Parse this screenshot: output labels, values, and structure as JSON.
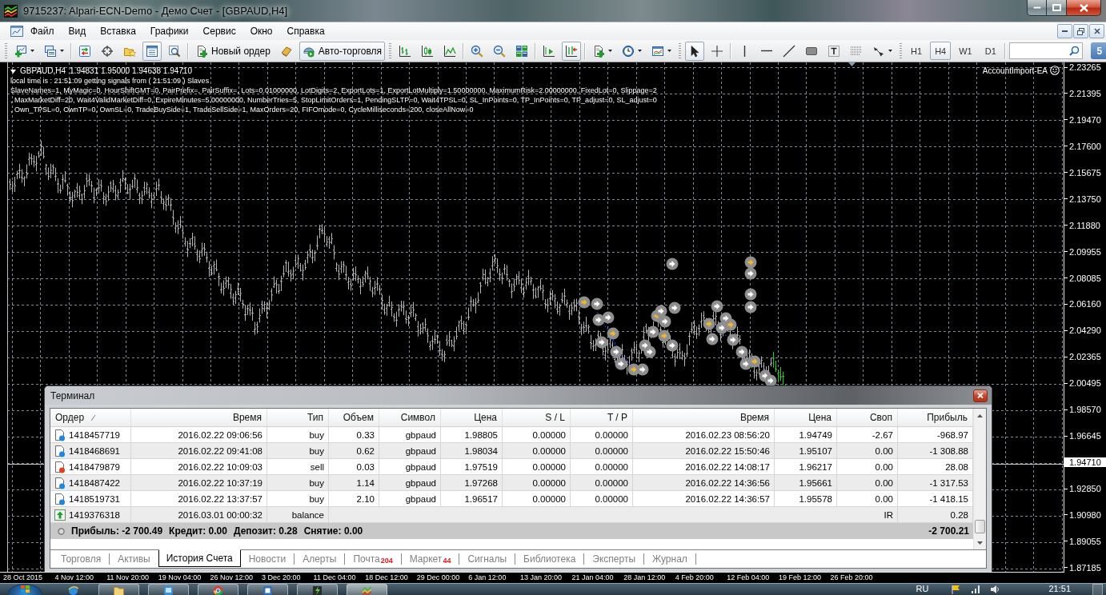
{
  "window": {
    "title": "9715237: Alpari-ECN-Demo - Демо Счет - [GBPAUD,H4]"
  },
  "menu": [
    "Файл",
    "Вид",
    "Вставка",
    "Графики",
    "Сервис",
    "Окно",
    "Справка"
  ],
  "toolbar": {
    "tools": [
      {
        "kind": "icon",
        "dropdown": true,
        "pressed": false
      },
      {
        "kind": "icon",
        "dropdown": true,
        "pressed": false
      },
      {
        "kind": "icon",
        "dropdown": false,
        "pressed": false
      },
      {
        "kind": "icon",
        "dropdown": false,
        "pressed": false
      },
      {
        "kind": "icon",
        "dropdown": false,
        "pressed": false
      },
      {
        "kind": "icon",
        "dropdown": false,
        "pressed": true
      },
      {
        "kind": "icon",
        "dropdown": false,
        "pressed": false
      },
      {
        "kind": "labeled",
        "label": "Новый ордер",
        "dropdown": false,
        "pressed": false
      },
      {
        "kind": "icon",
        "dropdown": false,
        "pressed": false
      },
      {
        "kind": "labeled",
        "label": "Авто-торговля",
        "dropdown": false,
        "pressed": true
      },
      {
        "kind": "icon",
        "dropdown": false,
        "pressed": false
      },
      {
        "kind": "icon",
        "dropdown": false,
        "pressed": false
      },
      {
        "kind": "icon",
        "dropdown": false,
        "pressed": false
      },
      {
        "kind": "icon",
        "dropdown": false,
        "pressed": false
      },
      {
        "kind": "icon",
        "dropdown": false,
        "pressed": false
      },
      {
        "kind": "icon",
        "dropdown": false,
        "pressed": false
      },
      {
        "kind": "icon",
        "dropdown": false,
        "pressed": false
      },
      {
        "kind": "icon",
        "dropdown": false,
        "pressed": true
      },
      {
        "kind": "icon",
        "dropdown": true,
        "pressed": false
      },
      {
        "kind": "icon",
        "dropdown": true,
        "pressed": false
      },
      {
        "kind": "icon",
        "dropdown": true,
        "pressed": false
      },
      {
        "kind": "icon",
        "dropdown": false,
        "pressed": true
      },
      {
        "kind": "icon",
        "dropdown": false,
        "pressed": false
      },
      {
        "kind": "icon",
        "dropdown": false,
        "pressed": false
      },
      {
        "kind": "icon",
        "dropdown": false,
        "pressed": false
      },
      {
        "kind": "icon",
        "dropdown": false,
        "pressed": false
      },
      {
        "kind": "icon",
        "dropdown": false,
        "pressed": false
      },
      {
        "kind": "icon",
        "dropdown": false,
        "pressed": false
      },
      {
        "kind": "icon",
        "dropdown": false,
        "pressed": false
      },
      {
        "kind": "icon",
        "dropdown": true,
        "pressed": false
      }
    ],
    "timeframes": [
      {
        "label": "H1",
        "selected": false
      },
      {
        "label": "H4",
        "selected": true
      },
      {
        "label": "W1",
        "selected": false
      },
      {
        "label": "D1",
        "selected": false
      }
    ],
    "notifications": "5"
  },
  "chart": {
    "symbol": "GBPAUD,H4",
    "quote": "1.94831 1.95000 1.94638 1.94710",
    "lines": [
      "local time is : 21:51:09 getting signals from ( 21:51:09 ) Slaves",
      "SlaveNames=1, MyMagic=0, HourShiftGMT=0, PairPrefix=, PairSuffix=, Lots=0.01000000, LotDigits=2, ExportLots=1, ExportLotMultiply=1.50000000, MaximumRisk=2.00000000, FixedLot=0, Slippage=2",
      ", MaxMarketDiff=20, Wait4ValidMarketDiff=0, ExpireMinutes=5.00000000, NumberTries=5, StopLimitOrders=1, PendingSLTP=0, Wait4TPSL=0, SL_InPoints=0, TP_InPoints=0, TP_adjust=0, SL_adjust=0",
      ", Own_TPSL=0, OwnTP=0, OwnSL=0, TradeBuySide=1, TradeSellSide=1, MaxOrders=20, FIFOmode=0, CycleMilliseconds=200, closeAllNow=0"
    ],
    "expert": "AccountImport-EA",
    "price_axis": [
      {
        "label": "2.23265",
        "current": false
      },
      {
        "label": "2.21395",
        "current": false
      },
      {
        "label": "2.19470",
        "current": false
      },
      {
        "label": "2.17600",
        "current": false
      },
      {
        "label": "2.15675",
        "current": false
      },
      {
        "label": "2.13750",
        "current": false
      },
      {
        "label": "2.11880",
        "current": false
      },
      {
        "label": "2.09955",
        "current": false
      },
      {
        "label": "2.08085",
        "current": false
      },
      {
        "label": "2.06160",
        "current": false
      },
      {
        "label": "2.04290",
        "current": false
      },
      {
        "label": "2.02365",
        "current": false
      },
      {
        "label": "2.00495",
        "current": false
      },
      {
        "label": "1.98570",
        "current": false
      },
      {
        "label": "1.96645",
        "current": false
      },
      {
        "label": "1.94710",
        "current": true
      },
      {
        "label": "1.92850",
        "current": false
      },
      {
        "label": "1.90980",
        "current": false
      },
      {
        "label": "1.89055",
        "current": false
      },
      {
        "label": "1.87185",
        "current": false
      }
    ],
    "time_axis": [
      "28 Oct 2015",
      "4 Nov 12:00",
      "11 Nov 20:00",
      "19 Nov 04:00",
      "26 Nov 12:00",
      "3 Dec 20:00",
      "11 Dec 04:00",
      "18 Dec 12:00",
      "29 Dec 00:00",
      "6 Jan 12:00",
      "13 Jan 20:00",
      "21 Jan 04:00",
      "28 Jan 12:00",
      "4 Feb 20:00",
      "12 Feb 04:00",
      "19 Feb 12:00",
      "26 Feb 20:00"
    ]
  },
  "terminal": {
    "title": "Терминал",
    "columns": [
      {
        "label": "Ордер",
        "sorted": true
      },
      {
        "label": "Время",
        "sorted": false
      },
      {
        "label": "Тип",
        "sorted": false
      },
      {
        "label": "Объем",
        "sorted": false
      },
      {
        "label": "Символ",
        "sorted": false
      },
      {
        "label": "Цена",
        "sorted": false
      },
      {
        "label": "S / L",
        "sorted": false
      },
      {
        "label": "T / P",
        "sorted": false
      },
      {
        "label": "Время",
        "sorted": false
      },
      {
        "label": "Цена",
        "sorted": false
      },
      {
        "label": "Своп",
        "sorted": false
      },
      {
        "label": "Прибыль",
        "sorted": false
      }
    ],
    "rows": [
      {
        "kind": "buy",
        "cells": [
          "1418457719",
          "2016.02.22 09:06:56",
          "buy",
          "0.33",
          "gbpaud",
          "1.98805",
          "0.00000",
          "0.00000",
          "2016.02.23 08:56:20",
          "1.94749",
          "-2.67",
          "-968.97"
        ]
      },
      {
        "kind": "buy",
        "cells": [
          "1418468691",
          "2016.02.22 09:41:08",
          "buy",
          "0.62",
          "gbpaud",
          "1.98034",
          "0.00000",
          "0.00000",
          "2016.02.22 15:50:46",
          "1.95107",
          "0.00",
          "-1 308.88"
        ]
      },
      {
        "kind": "sell",
        "cells": [
          "1418479879",
          "2016.02.22 10:09:03",
          "sell",
          "0.03",
          "gbpaud",
          "1.97519",
          "0.00000",
          "0.00000",
          "2016.02.22 14:08:17",
          "1.96217",
          "0.00",
          "28.08"
        ]
      },
      {
        "kind": "buy",
        "cells": [
          "1418487422",
          "2016.02.22 10:37:19",
          "buy",
          "1.14",
          "gbpaud",
          "1.97268",
          "0.00000",
          "0.00000",
          "2016.02.22 14:36:56",
          "1.95661",
          "0.00",
          "-1 317.53"
        ]
      },
      {
        "kind": "buy",
        "cells": [
          "1418519731",
          "2016.02.22 13:37:57",
          "buy",
          "2.10",
          "gbpaud",
          "1.96517",
          "0.00000",
          "0.00000",
          "2016.02.22 14:36:57",
          "1.95578",
          "0.00",
          "-1 418.15"
        ]
      },
      {
        "kind": "balance",
        "cells": [
          "1419376318",
          "2016.03.01 00:00:32",
          "balance"
        ],
        "comment": "IR",
        "profit": "0.28"
      }
    ],
    "summary": {
      "items": [
        {
          "label": "Прибыль:",
          "value": "-2 700.49"
        },
        {
          "label": "Кредит:",
          "value": "0.00"
        },
        {
          "label": "Депозит:",
          "value": "0.28"
        },
        {
          "label": "Снятие:",
          "value": "0.00"
        }
      ],
      "total": "-2 700.21"
    },
    "tabs": [
      {
        "label": "Торговля",
        "selected": false
      },
      {
        "label": "Активы",
        "selected": false
      },
      {
        "label": "История Счета",
        "selected": true
      },
      {
        "label": "Новости",
        "selected": false
      },
      {
        "label": "Алерты",
        "selected": false
      },
      {
        "label": "Почта",
        "count": "204",
        "selected": false
      },
      {
        "label": "Маркет",
        "count": "44",
        "selected": false
      },
      {
        "label": "Сигналы",
        "selected": false
      },
      {
        "label": "Библиотека",
        "selected": false
      },
      {
        "label": "Эксперты",
        "selected": false
      },
      {
        "label": "Журнал",
        "selected": false
      }
    ]
  },
  "taskbar": {
    "apps": [
      {
        "running": false,
        "active": false
      },
      {
        "running": true,
        "active": false
      },
      {
        "running": true,
        "active": false
      },
      {
        "running": true,
        "active": false
      },
      {
        "running": true,
        "active": false
      },
      {
        "running": true,
        "active": false
      },
      {
        "running": true,
        "active": true
      }
    ],
    "language": "RU",
    "clock": "21:51"
  }
}
